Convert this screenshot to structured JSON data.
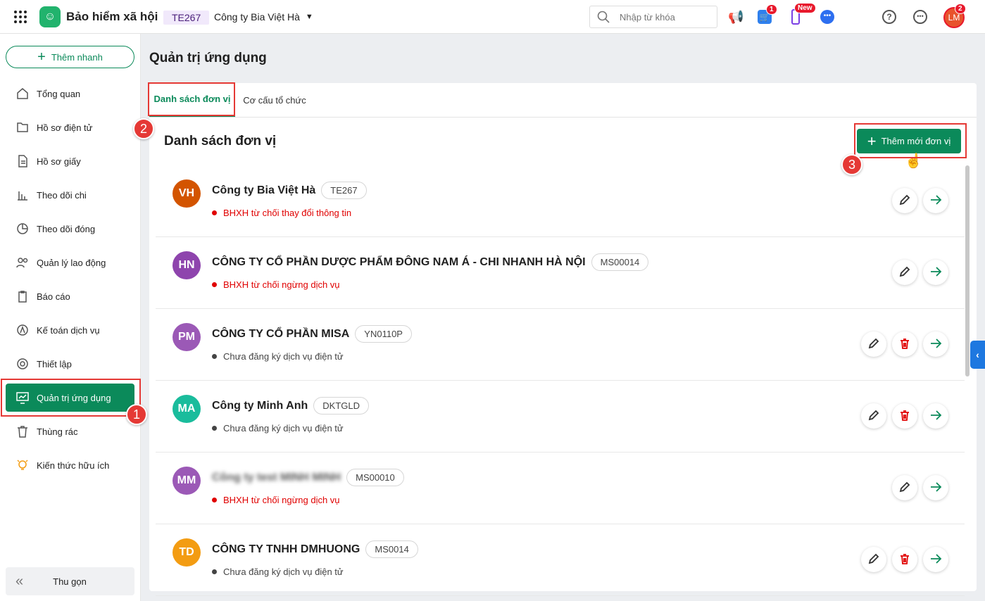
{
  "header": {
    "app_name": "Bảo hiểm xã hội",
    "unit_code": "TE267",
    "unit_name": "Công ty Bia Việt Hà",
    "search_placeholder": "Nhập từ khóa",
    "cart_badge": "1",
    "new_badge": "New",
    "avatar": "LM",
    "avatar_badge": "2"
  },
  "sidebar": {
    "quick_add": "Thêm nhanh",
    "items": [
      {
        "label": "Tổng quan"
      },
      {
        "label": "Hồ sơ điện tử"
      },
      {
        "label": "Hồ sơ giấy"
      },
      {
        "label": "Theo dõi chi"
      },
      {
        "label": "Theo dõi đóng"
      },
      {
        "label": "Quản lý lao động"
      },
      {
        "label": "Báo cáo"
      },
      {
        "label": "Kế toán dịch vụ"
      },
      {
        "label": "Thiết lập"
      },
      {
        "label": "Quản trị ứng dụng"
      },
      {
        "label": "Thùng rác"
      },
      {
        "label": "Kiến thức hữu ích"
      }
    ],
    "collapse": "Thu gọn"
  },
  "main": {
    "title": "Quản trị ứng dụng",
    "tabs": [
      {
        "label": "Danh sách đơn vị"
      },
      {
        "label": "Cơ cấu tổ chức"
      }
    ],
    "list_title": "Danh sách đơn vị",
    "add_button": "Thêm mới đơn vị",
    "units": [
      {
        "initials": "VH",
        "color": "#d35400",
        "name": "Công ty Bia Việt Hà",
        "code": "TE267",
        "status": "BHXH từ chối thay đổi thông tin",
        "status_color": "#e00000",
        "deletable": false
      },
      {
        "initials": "HN",
        "color": "#8e44ad",
        "name": "CÔNG TY CỔ PHẦN DƯỢC PHẨM ĐÔNG NAM Á - CHI NHANH HÀ NỘI",
        "code": "MS00014",
        "status": "BHXH từ chối ngừng dịch vụ",
        "status_color": "#e00000",
        "deletable": false
      },
      {
        "initials": "PM",
        "color": "#9b59b6",
        "name": "CÔNG TY CỔ PHẦN MISA",
        "code": "YN0110P",
        "status": "Chưa đăng ký dịch vụ điện tử",
        "status_color": "#444444",
        "deletable": true
      },
      {
        "initials": "MA",
        "color": "#1abc9c",
        "name": "Công ty Minh Anh",
        "code": "DKTGLD",
        "status": "Chưa đăng ký dịch vụ điện tử",
        "status_color": "#444444",
        "deletable": true
      },
      {
        "initials": "MM",
        "color": "#9b59b6",
        "name": "Công ty test MINH MINH",
        "code": "MS00010",
        "status": "BHXH từ chối ngừng dịch vụ",
        "status_color": "#e00000",
        "deletable": false,
        "blurred": true
      },
      {
        "initials": "TD",
        "color": "#f39c12",
        "name": "CÔNG TY TNHH DMHUONG",
        "code": "MS0014",
        "status": "Chưa đăng ký dịch vụ điện tử",
        "status_color": "#444444",
        "deletable": true
      }
    ]
  },
  "annotations": [
    "1",
    "2",
    "3"
  ]
}
